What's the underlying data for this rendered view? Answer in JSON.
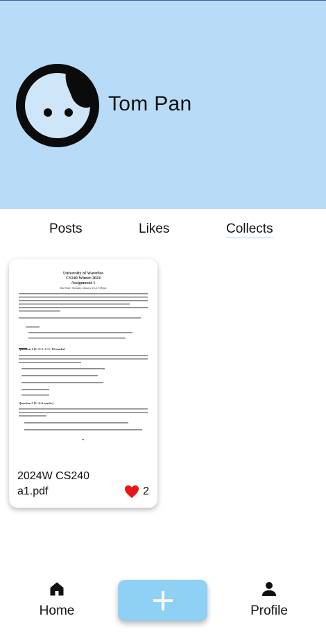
{
  "profile": {
    "name": "Tom Pan",
    "avatar_icon": "avatar-face-icon"
  },
  "tabs": [
    {
      "label": "Posts",
      "active": false
    },
    {
      "label": "Likes",
      "active": false
    },
    {
      "label": "Collects",
      "active": true
    }
  ],
  "card": {
    "title": "2024W CS240",
    "filename": "a1.pdf",
    "likes": "2",
    "like_icon": "heart-icon",
    "preview": {
      "lines": [
        "University of Waterloo",
        "CS240 Winter 2024",
        "Assignment 1",
        "Due Date: Tuesday, January 23 at 5:00pm",
        "Question 1    [2+2+2+2+2=10 marks]",
        "Question 2    [2+4=6 marks]"
      ]
    }
  },
  "nav": {
    "home_label": "Home",
    "home_icon": "home-icon",
    "add_icon": "plus-icon",
    "profile_label": "Profile",
    "profile_icon": "person-icon"
  },
  "colors": {
    "header_bg": "#b8dcf8",
    "add_button": "#8fd0f5",
    "heart": "#e8141a",
    "active_tab_underline": "#a9d2ef"
  }
}
